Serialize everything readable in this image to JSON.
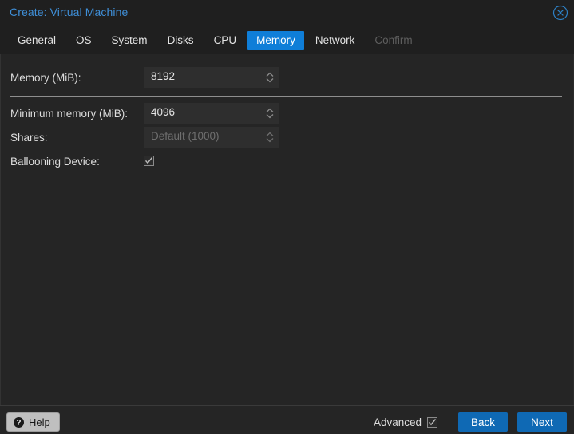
{
  "window": {
    "title": "Create: Virtual Machine",
    "close_icon": "close-circle-icon"
  },
  "tabs": [
    {
      "label": "General",
      "state": "normal"
    },
    {
      "label": "OS",
      "state": "normal"
    },
    {
      "label": "System",
      "state": "normal"
    },
    {
      "label": "Disks",
      "state": "normal"
    },
    {
      "label": "CPU",
      "state": "normal"
    },
    {
      "label": "Memory",
      "state": "active"
    },
    {
      "label": "Network",
      "state": "normal"
    },
    {
      "label": "Confirm",
      "state": "disabled"
    }
  ],
  "form": {
    "memory": {
      "label": "Memory (MiB):",
      "value": "8192",
      "is_placeholder": false
    },
    "minimum_memory": {
      "label": "Minimum memory (MiB):",
      "value": "4096",
      "is_placeholder": false
    },
    "shares": {
      "label": "Shares:",
      "value": "Default (1000)",
      "is_placeholder": true
    },
    "ballooning": {
      "label": "Ballooning Device:",
      "checked": true
    }
  },
  "footer": {
    "help_label": "Help",
    "help_icon": "question-mark-circle-icon",
    "advanced_label": "Advanced",
    "advanced_checked": true,
    "back_label": "Back",
    "next_label": "Next"
  },
  "colors": {
    "accent_blue": "#0f7ed8",
    "title_blue": "#3f8fd8",
    "button_blue": "#0f69b4",
    "background": "#252525",
    "chrome": "#1f1f1f",
    "input_bg": "#2e2e2e"
  }
}
